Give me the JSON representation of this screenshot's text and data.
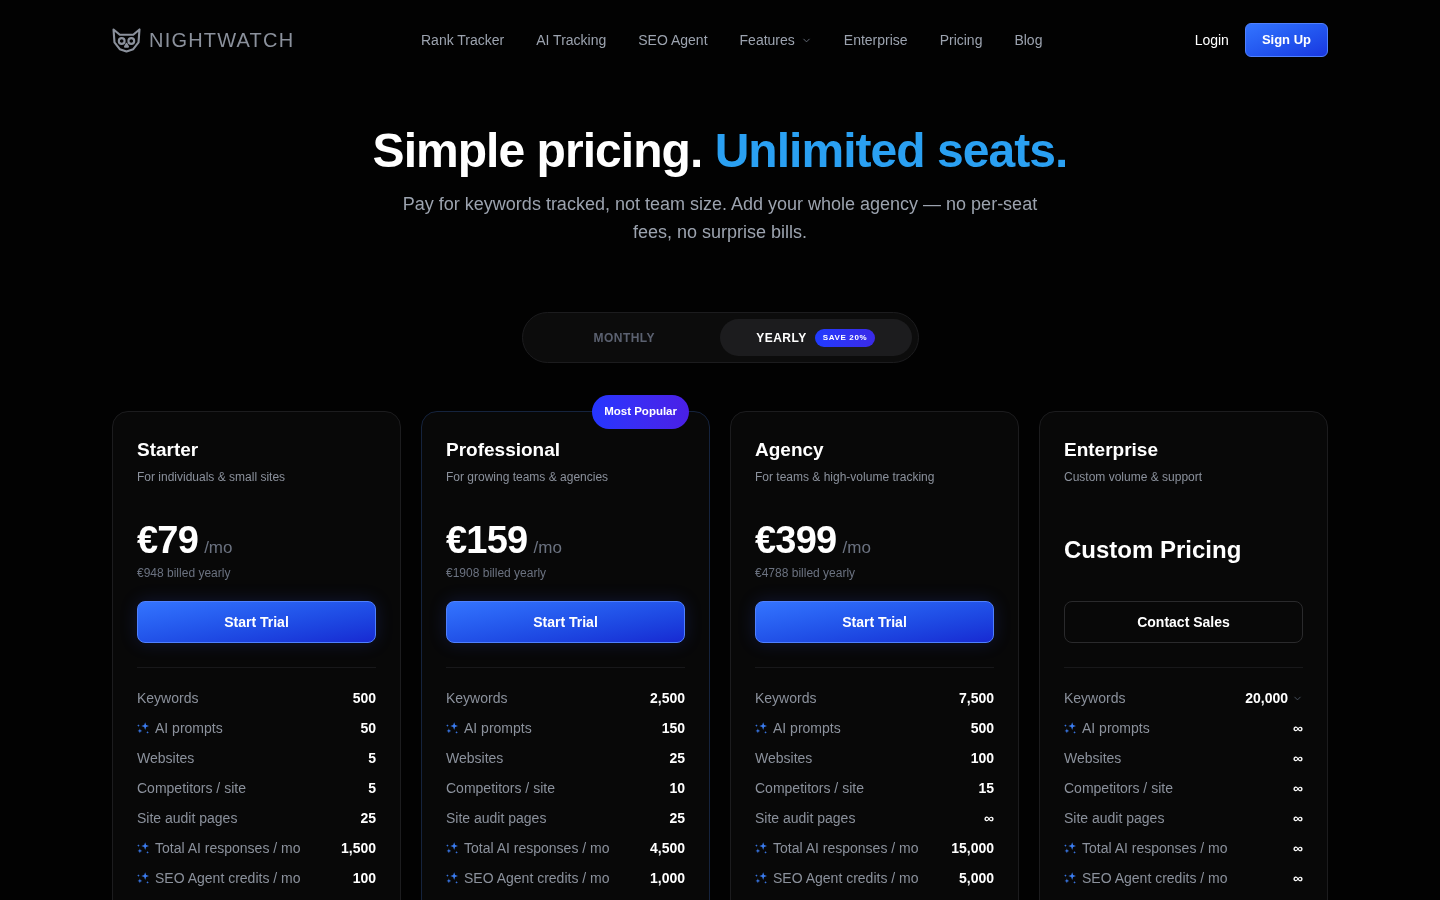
{
  "nav": {
    "logo": "NIGHTWATCH",
    "links": [
      {
        "label": "Rank Tracker",
        "kind": "link"
      },
      {
        "label": "AI Tracking",
        "kind": "link"
      },
      {
        "label": "SEO Agent",
        "kind": "link"
      },
      {
        "label": "Features",
        "kind": "dropdown"
      },
      {
        "label": "Enterprise",
        "kind": "link"
      },
      {
        "label": "Pricing",
        "kind": "link"
      },
      {
        "label": "Blog",
        "kind": "link"
      }
    ],
    "login": "Login",
    "signup": "Sign Up"
  },
  "hero": {
    "title": "Simple pricing.",
    "highlight": "Unlimited seats.",
    "subtitle": "Pay for keywords tracked, not team size. Add your whole agency — no per-seat fees, no surprise bills."
  },
  "billing_toggle": {
    "options": [
      {
        "label": "MONTHLY",
        "selected": false
      },
      {
        "label": "YEARLY",
        "selected": true,
        "badge": "SAVE 20%"
      }
    ]
  },
  "plans": [
    {
      "name": "Starter",
      "description": "For individuals & small sites",
      "featured": false,
      "price": {
        "kind": "amount",
        "amount": "€79",
        "period": "/mo",
        "billed": "€948 billed yearly"
      },
      "button": {
        "label": "Start Trial",
        "kind": "primary"
      },
      "features": [
        {
          "label": "Keywords",
          "value": "500",
          "ai": false,
          "kind": "value"
        },
        {
          "label": "AI prompts",
          "value": "50",
          "ai": true,
          "kind": "value"
        },
        {
          "label": "Websites",
          "value": "5",
          "ai": false,
          "kind": "value"
        },
        {
          "label": "Competitors / site",
          "value": "5",
          "ai": false,
          "kind": "value"
        },
        {
          "label": "Site audit pages",
          "value": "25",
          "ai": false,
          "kind": "value"
        },
        {
          "label": "Total AI responses / mo",
          "value": "1,500",
          "ai": true,
          "kind": "value"
        },
        {
          "label": "SEO Agent credits / mo",
          "value": "100",
          "ai": true,
          "kind": "value"
        }
      ]
    },
    {
      "name": "Professional",
      "description": "For growing teams & agencies",
      "featured": true,
      "badge": "Most Popular",
      "price": {
        "kind": "amount",
        "amount": "€159",
        "period": "/mo",
        "billed": "€1908 billed yearly"
      },
      "button": {
        "label": "Start Trial",
        "kind": "primary"
      },
      "features": [
        {
          "label": "Keywords",
          "value": "2,500",
          "ai": false,
          "kind": "value"
        },
        {
          "label": "AI prompts",
          "value": "150",
          "ai": true,
          "kind": "value"
        },
        {
          "label": "Websites",
          "value": "25",
          "ai": false,
          "kind": "value"
        },
        {
          "label": "Competitors / site",
          "value": "10",
          "ai": false,
          "kind": "value"
        },
        {
          "label": "Site audit pages",
          "value": "25",
          "ai": false,
          "kind": "value"
        },
        {
          "label": "Total AI responses / mo",
          "value": "4,500",
          "ai": true,
          "kind": "value"
        },
        {
          "label": "SEO Agent credits / mo",
          "value": "1,000",
          "ai": true,
          "kind": "value"
        }
      ]
    },
    {
      "name": "Agency",
      "description": "For teams & high-volume tracking",
      "featured": false,
      "price": {
        "kind": "amount",
        "amount": "€399",
        "period": "/mo",
        "billed": "€4788 billed yearly"
      },
      "button": {
        "label": "Start Trial",
        "kind": "primary"
      },
      "features": [
        {
          "label": "Keywords",
          "value": "7,500",
          "ai": false,
          "kind": "value"
        },
        {
          "label": "AI prompts",
          "value": "500",
          "ai": true,
          "kind": "value"
        },
        {
          "label": "Websites",
          "value": "100",
          "ai": false,
          "kind": "value"
        },
        {
          "label": "Competitors / site",
          "value": "15",
          "ai": false,
          "kind": "value"
        },
        {
          "label": "Site audit pages",
          "value": "∞",
          "ai": false,
          "kind": "value"
        },
        {
          "label": "Total AI responses / mo",
          "value": "15,000",
          "ai": true,
          "kind": "value"
        },
        {
          "label": "SEO Agent credits / mo",
          "value": "5,000",
          "ai": true,
          "kind": "value"
        }
      ]
    },
    {
      "name": "Enterprise",
      "description": "Custom volume & support",
      "featured": false,
      "price": {
        "kind": "custom",
        "label": "Custom Pricing"
      },
      "button": {
        "label": "Contact Sales",
        "kind": "outline"
      },
      "features": [
        {
          "label": "Keywords",
          "value": "20,000",
          "ai": false,
          "kind": "select"
        },
        {
          "label": "AI prompts",
          "value": "∞",
          "ai": true,
          "kind": "value"
        },
        {
          "label": "Websites",
          "value": "∞",
          "ai": false,
          "kind": "value"
        },
        {
          "label": "Competitors / site",
          "value": "∞",
          "ai": false,
          "kind": "value"
        },
        {
          "label": "Site audit pages",
          "value": "∞",
          "ai": false,
          "kind": "value"
        },
        {
          "label": "Total AI responses / mo",
          "value": "∞",
          "ai": true,
          "kind": "value"
        },
        {
          "label": "SEO Agent credits / mo",
          "value": "∞",
          "ai": true,
          "kind": "value"
        }
      ]
    }
  ]
}
